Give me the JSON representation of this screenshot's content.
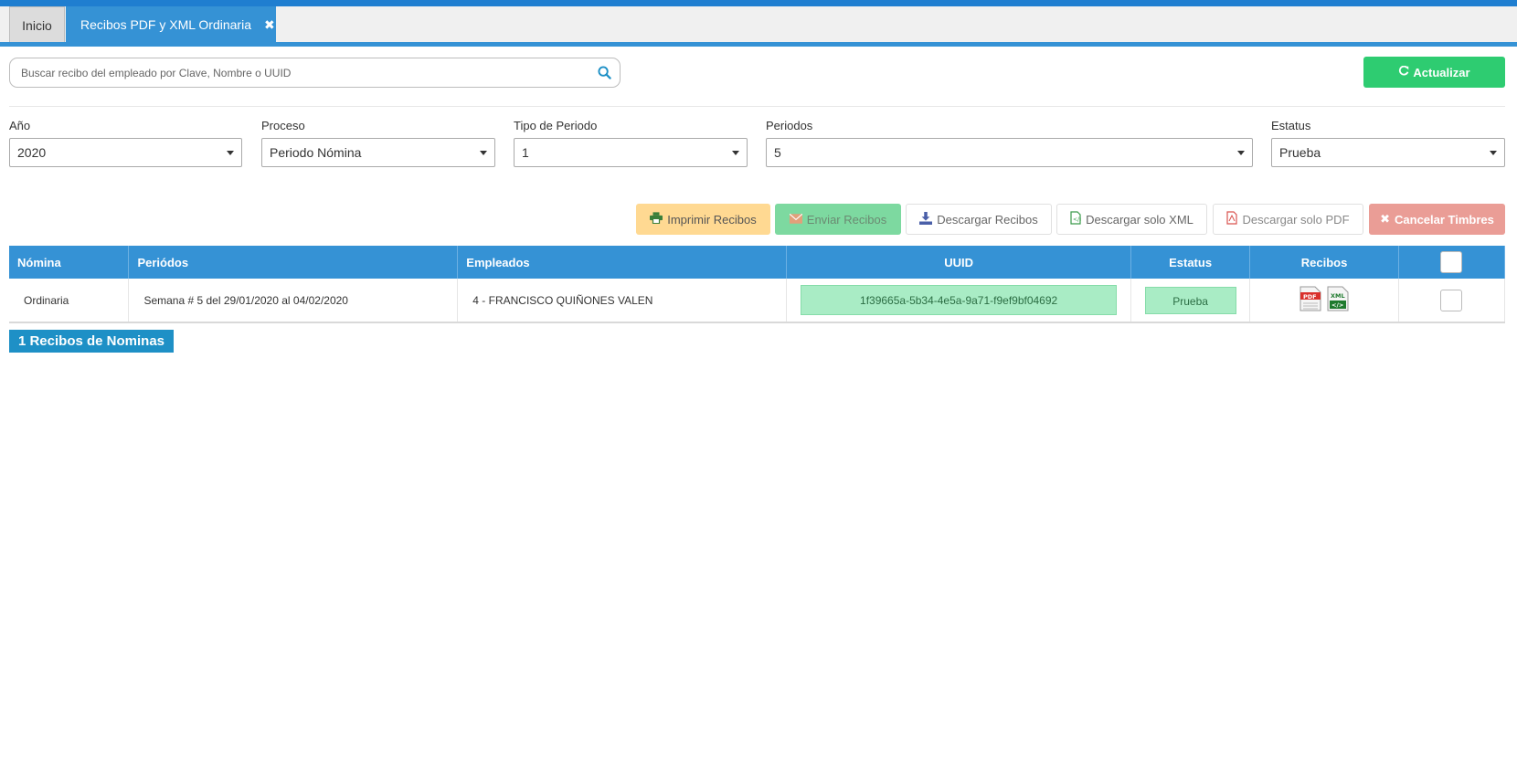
{
  "tabs": {
    "inicio": "Inicio",
    "active": "Recibos PDF y XML Ordinaria",
    "close": "✖"
  },
  "search": {
    "placeholder": "Buscar recibo del empleado por Clave, Nombre o UUID"
  },
  "actualizar": "Actualizar",
  "filters": {
    "anio": {
      "label": "Año",
      "value": "2020"
    },
    "proceso": {
      "label": "Proceso",
      "value": "Periodo Nómina"
    },
    "tipo": {
      "label": "Tipo de Periodo",
      "value": "1"
    },
    "periodos": {
      "label": "Periodos",
      "value": "5"
    },
    "estatus": {
      "label": "Estatus",
      "value": "Prueba"
    }
  },
  "actions": {
    "imprimir": "Imprimir Recibos",
    "enviar": "Enviar Recibos",
    "descargar": "Descargar Recibos",
    "xml": "Descargar solo XML",
    "pdf": "Descargar solo PDF",
    "cancelar": "Cancelar Timbres"
  },
  "table": {
    "headers": {
      "nomina": "Nómina",
      "periodos": "Periódos",
      "empleados": "Empleados",
      "uuid": "UUID",
      "estatus": "Estatus",
      "recibos": "Recibos"
    },
    "rows": [
      {
        "nomina": "Ordinaria",
        "periodo": "Semana # 5 del 29/01/2020 al 04/02/2020",
        "empleado": "4 - FRANCISCO QUIÑONES VALEN",
        "uuid": "1f39665a-5b34-4e5a-9a71-f9ef9bf04692",
        "estatus": "Prueba",
        "pdf_label": "PDF",
        "xml_label": "XML"
      }
    ]
  },
  "footer": "1 Recibos de Nominas",
  "colors": {
    "primary": "#3592d5",
    "success": "#2ecc71",
    "warning": "#ffd992",
    "danger": "#ea9d96"
  }
}
